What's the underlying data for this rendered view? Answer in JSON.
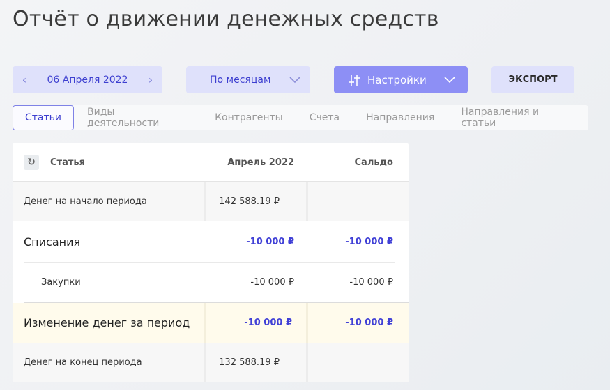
{
  "page": {
    "title": "Отчёт о движении денежных средств"
  },
  "toolbar": {
    "date": "06 Апреля 2022",
    "period": "По месяцам",
    "settings_label": "Настройки",
    "export_label": "ЭКСПОРТ"
  },
  "tabs": [
    {
      "label": "Статьи",
      "active": true
    },
    {
      "label": "Виды деятельности",
      "active": false
    },
    {
      "label": "Контрагенты",
      "active": false
    },
    {
      "label": "Счета",
      "active": false
    },
    {
      "label": "Направления",
      "active": false
    },
    {
      "label": "Направления и статьи",
      "active": false
    }
  ],
  "table": {
    "headers": {
      "article": "Статья",
      "month": "Апрель 2022",
      "balance": "Сальдо"
    },
    "rows": [
      {
        "label": "Денег на начало периода",
        "month": "142 588.19 ₽",
        "balance": ""
      },
      {
        "label": "Списания",
        "month": "-10 000 ₽",
        "balance": "-10 000 ₽"
      },
      {
        "label": "Закупки",
        "month": "-10 000 ₽",
        "balance": "-10 000 ₽"
      },
      {
        "label": "Изменение денег за период",
        "month": "-10 000 ₽",
        "balance": "-10 000 ₽"
      },
      {
        "label": "Денег на конец периода",
        "month": "132 588.19 ₽",
        "balance": ""
      }
    ]
  },
  "colors": {
    "accent": "#3d3fd0",
    "primary_button": "#8d8ff5",
    "soft_button": "#dfe1fb"
  },
  "icons": [
    "chevron-left-icon",
    "chevron-right-icon",
    "chevron-down-icon",
    "sliders-icon",
    "refresh-icon"
  ]
}
